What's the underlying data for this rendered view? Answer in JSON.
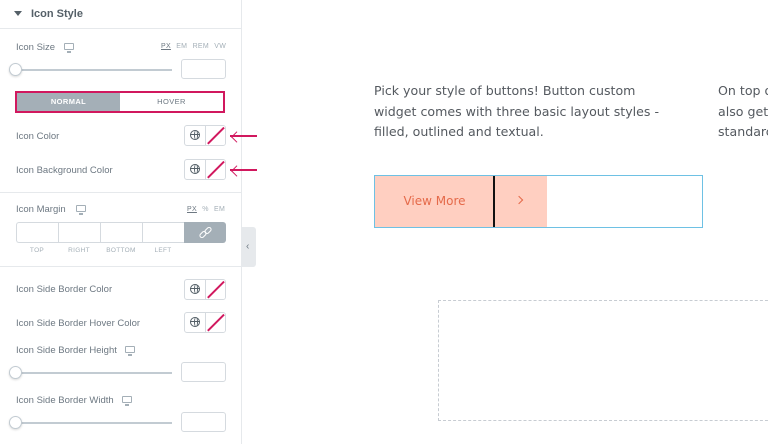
{
  "panel": {
    "section_title": "Icon Style",
    "icon_size": {
      "label": "Icon Size",
      "units": [
        "PX",
        "EM",
        "REM",
        "VW"
      ],
      "active_unit": "PX",
      "value": ""
    },
    "tabs": {
      "normal": "NORMAL",
      "hover": "HOVER",
      "active": "NORMAL"
    },
    "icon_color": {
      "label": "Icon Color"
    },
    "icon_bg_color": {
      "label": "Icon Background Color"
    },
    "icon_margin": {
      "label": "Icon Margin",
      "units": [
        "PX",
        "%",
        "EM"
      ],
      "active_unit": "PX",
      "sides": [
        "TOP",
        "RIGHT",
        "BOTTOM",
        "LEFT"
      ]
    },
    "side_border_color": {
      "label": "Icon Side Border Color"
    },
    "side_border_hover_color": {
      "label": "Icon Side Border Hover Color"
    },
    "side_border_height": {
      "label": "Icon Side Border Height",
      "value": ""
    },
    "side_border_width": {
      "label": "Icon Side Border Width",
      "value": ""
    },
    "collapse_glyph": "‹"
  },
  "preview": {
    "description_lines": [
      "Pick your style of buttons! Button custom",
      "widget comes with three basic layout styles -",
      "filled, outlined and textual."
    ],
    "side_text_lines": [
      "On top o",
      "also get",
      "standarc"
    ],
    "button_label": "View More"
  },
  "colors": {
    "highlight": "#d1185e",
    "button_bg": "#ffcfc1",
    "button_text": "#e56a4a",
    "frame": "#6ec1e4"
  },
  "icons": [
    "caret-down-icon",
    "desktop-icon",
    "globe-icon",
    "clear-color-icon",
    "link-icon",
    "chevron-right-icon",
    "annotation-arrow-icon"
  ]
}
